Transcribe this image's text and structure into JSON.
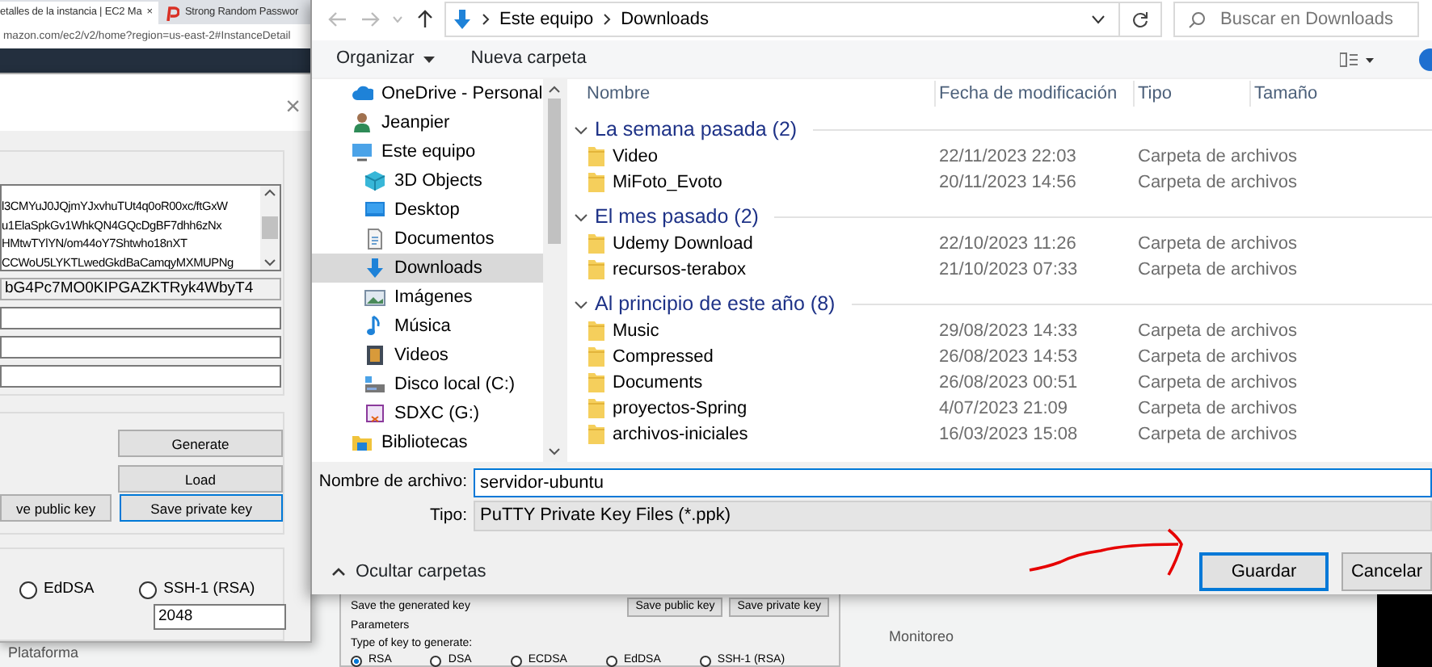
{
  "browser": {
    "tabs": [
      {
        "title": "etalles de la instancia | EC2 Ma",
        "close": "×",
        "selected": true
      },
      {
        "title": "Strong Random Passwor",
        "selected": false
      }
    ],
    "address": "mazon.com/ec2/v2/home?region=us-east-2#InstanceDetail",
    "page_texts": {
      "platform": "Plataforma",
      "monitoring": "Monitoreo"
    },
    "embedded_puttygen": {
      "save_label": "Save the generated key",
      "buttons": [
        {
          "label": "Save public key"
        },
        {
          "label": "Save private key"
        }
      ],
      "parameters_label": "Parameters",
      "type_label": "Type of key to generate:",
      "key_types": [
        {
          "label": "RSA",
          "selected": true
        },
        {
          "label": "DSA",
          "selected": false
        },
        {
          "label": "ECDSA",
          "selected": false
        },
        {
          "label": "EdDSA",
          "selected": false
        },
        {
          "label": "SSH-1 (RSA)",
          "selected": false
        }
      ]
    }
  },
  "puttygen": {
    "close": "×",
    "key_lines": [
      "l3CMYuJ0JQjmYJxvhuTUt4q0oR00xc/ftGxW",
      "u1ElaSpkGv1WhkQN4GQcDgBF7dhh6zNx",
      "HMtwTYlYN/om44oY7Shtwho18nXT",
      "CCWoU5LYKTLwedGkdBaCamqyMXMUPNg"
    ],
    "fingerprint": "bG4Pc7MO0KIPGAZKTRyk4WbyT4",
    "buttons": [
      {
        "label": "Generate",
        "focused": false
      },
      {
        "label": "Load",
        "focused": false
      },
      {
        "label": "ve public key",
        "focused": false
      },
      {
        "label": "Save private key",
        "focused": true
      }
    ],
    "key_types": [
      {
        "label": "EdDSA",
        "selected": false
      },
      {
        "label": "SSH-1 (RSA)",
        "selected": false
      }
    ],
    "bits": "2048"
  },
  "dialog": {
    "breadcrumb": [
      "Este equipo",
      "Downloads"
    ],
    "search_placeholder": "Buscar en Downloads",
    "toolbar": [
      "Organizar",
      "Nueva carpeta"
    ],
    "sidebar": [
      {
        "label": "OneDrive - Personal",
        "kind": "cloud",
        "selected": false
      },
      {
        "label": "Jeanpier",
        "kind": "user",
        "selected": false
      },
      {
        "label": "Este equipo",
        "kind": "computer",
        "selected": false,
        "children": [
          {
            "label": "3D Objects",
            "kind": "cube",
            "selected": false
          },
          {
            "label": "Desktop",
            "kind": "desktop",
            "selected": false
          },
          {
            "label": "Documentos",
            "kind": "document",
            "selected": false
          },
          {
            "label": "Downloads",
            "kind": "download",
            "selected": true
          },
          {
            "label": "Imágenes",
            "kind": "pictures",
            "selected": false
          },
          {
            "label": "Música",
            "kind": "music",
            "selected": false
          },
          {
            "label": "Videos",
            "kind": "video",
            "selected": false
          },
          {
            "label": "Disco local (C:)",
            "kind": "drive",
            "selected": false
          },
          {
            "label": "SDXC (G:)",
            "kind": "sdcard",
            "selected": false
          }
        ]
      },
      {
        "label": "Bibliotecas",
        "kind": "library",
        "selected": false
      }
    ],
    "columns": [
      "Nombre",
      "Fecha de modificación",
      "Tipo",
      "Tamaño"
    ],
    "groups": [
      {
        "title": "La semana pasada (2)",
        "expanded": true,
        "rows": [
          {
            "name": "Video",
            "date": "22/11/2023 22:03",
            "type": "Carpeta de archivos"
          },
          {
            "name": "MiFoto_Evoto",
            "date": "20/11/2023 14:56",
            "type": "Carpeta de archivos"
          }
        ]
      },
      {
        "title": "El mes pasado (2)",
        "expanded": true,
        "rows": [
          {
            "name": "Udemy Download",
            "date": "22/10/2023 11:26",
            "type": "Carpeta de archivos"
          },
          {
            "name": "recursos-terabox",
            "date": "21/10/2023 07:33",
            "type": "Carpeta de archivos"
          }
        ]
      },
      {
        "title": "Al principio de este año (8)",
        "expanded": true,
        "rows": [
          {
            "name": "Music",
            "date": "29/08/2023 14:33",
            "type": "Carpeta de archivos"
          },
          {
            "name": "Compressed",
            "date": "26/08/2023 14:53",
            "type": "Carpeta de archivos"
          },
          {
            "name": "Documents",
            "date": "26/08/2023 00:51",
            "type": "Carpeta de archivos"
          },
          {
            "name": "proyectos-Spring",
            "date": "4/07/2023 21:09",
            "type": "Carpeta de archivos"
          },
          {
            "name": "archivos-iniciales",
            "date": "16/03/2023 15:08",
            "type": "Carpeta de archivos"
          }
        ]
      }
    ],
    "filename_label": "Nombre de archivo:",
    "filename": "servidor-ubuntu",
    "type_label": "Tipo:",
    "type": "PuTTY Private Key Files (*.ppk)",
    "hide_folders": "Ocultar carpetas",
    "buttons": [
      {
        "label": "Guardar",
        "default": true
      },
      {
        "label": "Cancelar",
        "default": false
      }
    ]
  }
}
